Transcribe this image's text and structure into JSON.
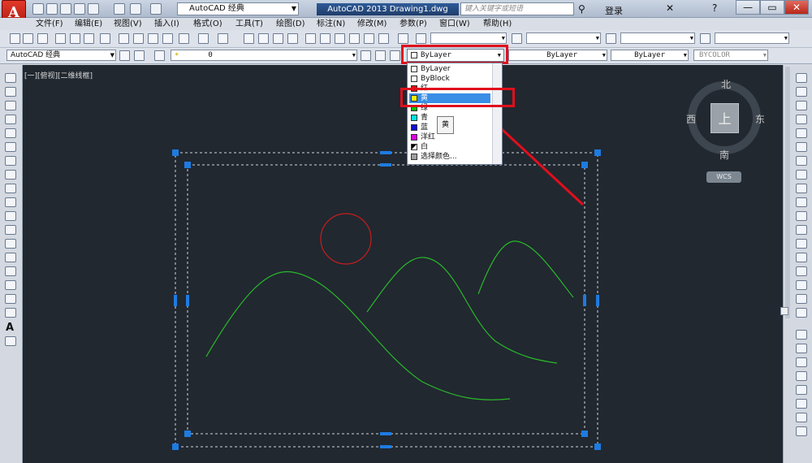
{
  "titlebar": {
    "workspace": "AutoCAD 经典",
    "title": "AutoCAD 2013    Drawing1.dwg",
    "search_placeholder": "键入关键字或短语",
    "login": "登录",
    "min": "—",
    "restore": "▭",
    "close": "✕"
  },
  "menu": [
    "文件(F)",
    "编辑(E)",
    "视图(V)",
    "插入(I)",
    "格式(O)",
    "工具(T)",
    "绘图(D)",
    "标注(N)",
    "修改(M)",
    "参数(P)",
    "窗口(W)",
    "帮助(H)"
  ],
  "toolbar2": {
    "workspace_combo": "AutoCAD 经典",
    "layer_value": "0",
    "color_value": "ByLayer",
    "linetype_value": "ByLayer",
    "lineweight_value": "ByLayer",
    "plotstyle_value": "BYCOLOR"
  },
  "view_label": "[一][俯视][二维线框]",
  "color_dropdown": {
    "items": [
      {
        "label": "ByLayer",
        "color": "#ffffff"
      },
      {
        "label": "ByBlock",
        "color": "#ffffff"
      },
      {
        "label": "红",
        "color": "#e01010"
      },
      {
        "label": "黄",
        "color": "#f0f000"
      },
      {
        "label": "绿",
        "color": "#00c000"
      },
      {
        "label": "青",
        "color": "#00e0e0"
      },
      {
        "label": "蓝",
        "color": "#1010d0"
      },
      {
        "label": "洋红",
        "color": "#e000e0"
      },
      {
        "label": "白",
        "color": "#ffffff"
      },
      {
        "label": "选择颜色...",
        "color": "#a0a0a0"
      }
    ],
    "selected": "黄",
    "tooltip": "黄"
  },
  "viewcube": {
    "north": "北",
    "south": "南",
    "west": "西",
    "east": "东",
    "top": "上",
    "wcs": "WCS"
  },
  "colors": {
    "canvas_bg": "#212830",
    "highlight": "#e00f1c",
    "selection_blue": "#1e7be0",
    "sun_red": "#c81d1d",
    "mountain_green": "#2ab82a"
  }
}
